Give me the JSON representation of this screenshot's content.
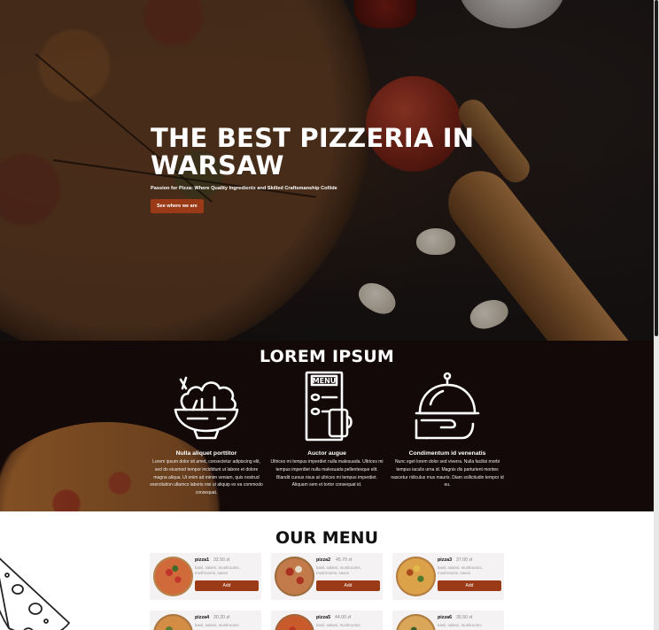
{
  "hero": {
    "title": "THE BEST PIZZERIA IN\nWARSAW",
    "subtitle": "Passion for Pizza: Where Quality Ingredients and Skilled Craftsmanship Collide",
    "cta_label": "See where we are",
    "accent": "#9b3a17"
  },
  "features": {
    "title": "LOREM IPSUM",
    "items": [
      {
        "icon": "salad-bowl-icon",
        "name": "Nulla aliquet porttitor",
        "text": "Lorem ipsum dolor sit amet, consectetur adipiscing elit, sed do eiusmod tempor incididunt ut labore et dolore magna aliqua. Ut enim ad minim veniam, quis nostrud exercitation ullamco laboris nisi ut aliquip ex ea commodo consequat."
      },
      {
        "icon": "menu-card-icon",
        "name": "Auctor augue",
        "text": "Ultrices mi tempus imperdiet nulla malesuada. Ultrices mi tempus imperdiet nulla malesuada pellentesque elit. Blandit cursus risus at ultrices mi tempus imperdiet. Aliquam sem et tortor consequat id."
      },
      {
        "icon": "serving-cloche-icon",
        "name": "Condimentum id venenatis",
        "text": "Nunc eget lorem dolor sed viverra. Nulla facilisi morbi tempus iaculis urna id. Magnis dis parturient montes nascetur ridiculus mus mauris. Diam sollicitudin tempor id eu."
      }
    ]
  },
  "menu": {
    "title": "OUR MENU",
    "add_label": "Add",
    "items": [
      {
        "name": "pizza1",
        "price": "32.50 zł",
        "desc": "basil, salami, mushrooms, mushrooms, sauce"
      },
      {
        "name": "pizza2",
        "price": "45.70 zł",
        "desc": "basil, salami, mushrooms, mushrooms, sauce"
      },
      {
        "name": "pizza3",
        "price": "37.00 zł",
        "desc": "basil, salami, mushrooms, mushrooms, sauce"
      },
      {
        "name": "pizza4",
        "price": "30.20 zł",
        "desc": "basil, salami, mushrooms"
      },
      {
        "name": "pizza5",
        "price": "44.00 zł",
        "desc": "basil, salami, mushrooms"
      },
      {
        "name": "pizza6",
        "price": "35.50 zł",
        "desc": "basil, salami, mushrooms"
      }
    ]
  }
}
